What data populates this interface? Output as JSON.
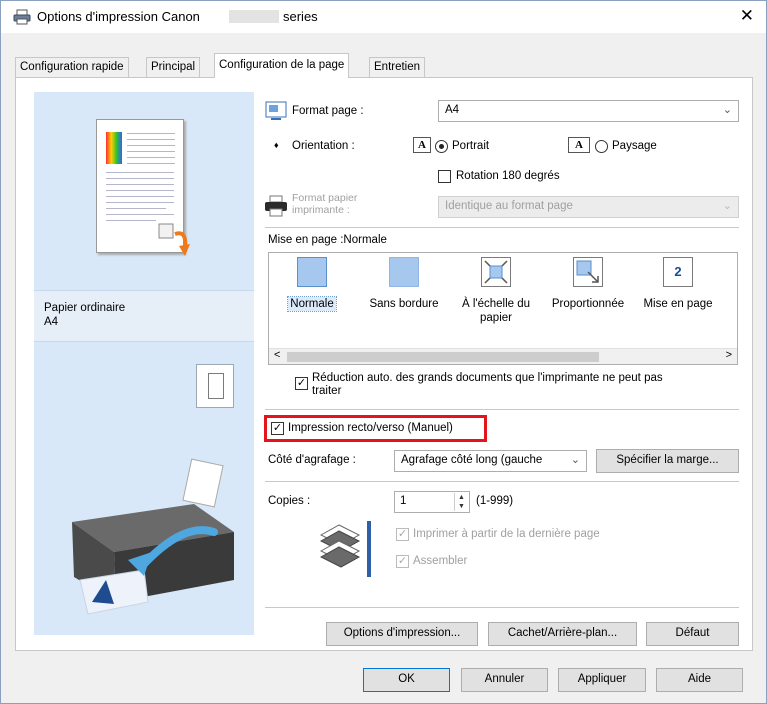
{
  "window": {
    "title_prefix": "Options d'impression Canon",
    "title_suffix": "series",
    "close_symbol": "✕"
  },
  "tabs": [
    {
      "label": "Configuration rapide"
    },
    {
      "label": "Principal"
    },
    {
      "label": "Configuration de la page"
    },
    {
      "label": "Entretien"
    }
  ],
  "preview": {
    "paper_type": "Papier ordinaire",
    "paper_size": "A4"
  },
  "page_setup": {
    "format_label": "Format page :",
    "format_value": "A4",
    "orientation_label": "Orientation :",
    "orientation_icon_letter": "A",
    "portrait_label": "Portrait",
    "landscape_label": "Paysage",
    "orientation_selected": "Portrait",
    "rotation_label": "Rotation 180 degrés",
    "rotation_checked": false,
    "printer_paper_label_1": "Format papier",
    "printer_paper_label_2": "imprimante :",
    "printer_paper_value": "Identique au format page"
  },
  "layout": {
    "heading": "Mise en page :Normale",
    "items": [
      {
        "label": "Normale",
        "selected": true
      },
      {
        "label": "Sans bordure",
        "selected": false
      },
      {
        "label": "À l'échelle du papier",
        "selected": false
      },
      {
        "label": "Proportionnée",
        "selected": false
      },
      {
        "label": "Mise en page",
        "selected": false
      }
    ],
    "page_number_icon_text": "2",
    "scroll_left": "<",
    "scroll_right": ">"
  },
  "auto_reduce": {
    "line1": "Réduction auto. des grands documents que l'imprimante ne peut pas",
    "line2": "traiter",
    "checked": true
  },
  "duplex": {
    "label": "Impression recto/verso (Manuel)",
    "checked": true,
    "highlight_color": "#e3141a"
  },
  "stapling": {
    "label": "Côté d'agrafage :",
    "value": "Agrafage côté long (gauche",
    "margin_button": "Spécifier la marge..."
  },
  "copies": {
    "label": "Copies :",
    "value": "1",
    "range": "(1-999)",
    "last_page_first_label": "Imprimer à partir de la dernière page",
    "collate_label": "Assembler",
    "last_page_first_checked": true,
    "collate_checked": true
  },
  "bottom_buttons": {
    "print_options": "Options d'impression...",
    "stamp_background": "Cachet/Arrière-plan...",
    "defaults": "Défaut"
  },
  "dialog_buttons": {
    "ok": "OK",
    "cancel": "Annuler",
    "apply": "Appliquer",
    "help": "Aide"
  },
  "colors": {
    "preview_bg": "#d8e8f8",
    "accent_blue": "#a7c8ee",
    "highlight_red": "#e3141a"
  }
}
